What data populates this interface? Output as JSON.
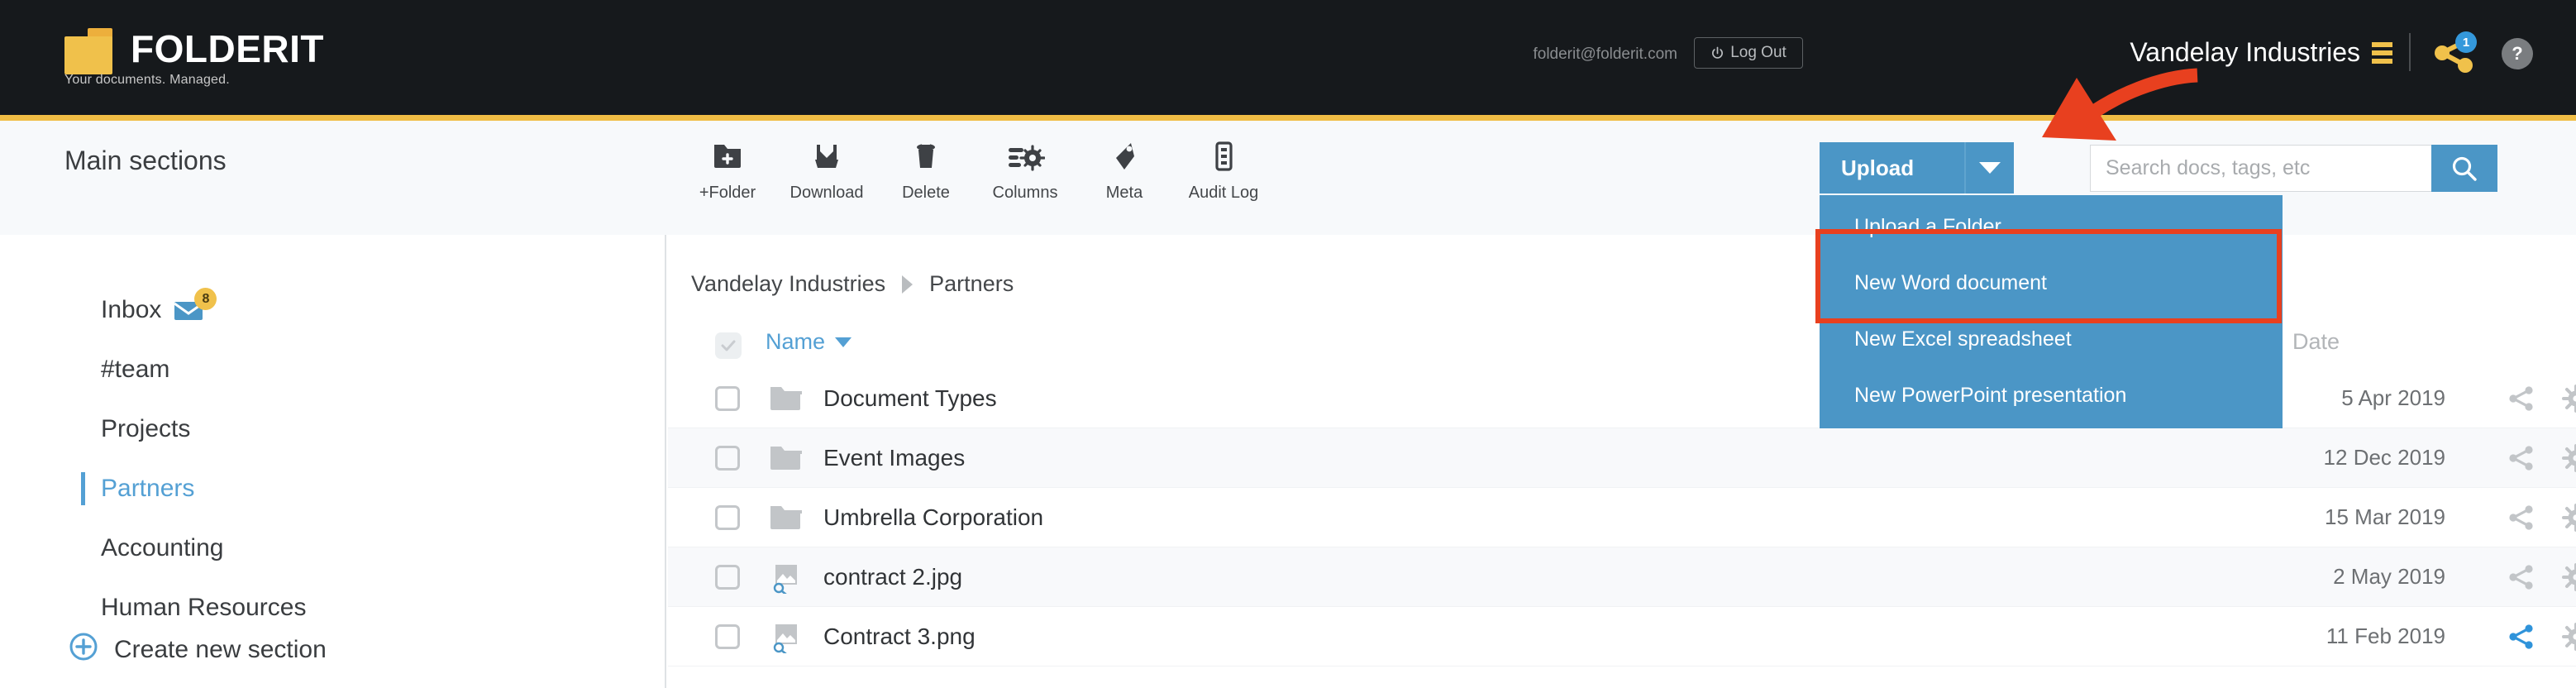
{
  "brand": {
    "name": "FOLDERIT",
    "tagline": "Your documents. Managed.",
    "logo_icon": "folder-logo-icon"
  },
  "header": {
    "account_email": "folderit@folderit.com",
    "logout_label": "Log Out",
    "logout_icon": "power-icon",
    "org_name": "Vandelay Industries",
    "menu_icon": "hamburger-icon",
    "share_icon": "share-icon",
    "share_badge_count": "1",
    "help_icon": "question-mark-icon",
    "help_label": "?"
  },
  "toolbar": {
    "section_title": "Main sections",
    "items": [
      {
        "label": "+Folder",
        "icon": "folder-plus-icon"
      },
      {
        "label": "Download",
        "icon": "download-tray-icon"
      },
      {
        "label": "Delete",
        "icon": "trash-icon"
      },
      {
        "label": "Columns",
        "icon": "columns-settings-icon"
      },
      {
        "label": "Meta",
        "icon": "tag-icon"
      },
      {
        "label": "Audit Log",
        "icon": "audit-log-icon"
      }
    ]
  },
  "upload": {
    "button_label": "Upload",
    "caret_icon": "chevron-down-icon",
    "menu_items": [
      {
        "label": "Upload a Folder"
      },
      {
        "label": "New Word document"
      },
      {
        "label": "New Excel spreadsheet"
      },
      {
        "label": "New PowerPoint presentation"
      }
    ]
  },
  "search": {
    "value": "",
    "placeholder": "Search docs, tags, etc",
    "button_icon": "search-icon"
  },
  "sidebar": {
    "items": [
      {
        "label": "Inbox",
        "badge": "8",
        "icon": "envelope-icon",
        "active": false
      },
      {
        "label": "#team",
        "active": false
      },
      {
        "label": "Projects",
        "active": false
      },
      {
        "label": "Partners",
        "active": true
      },
      {
        "label": "Accounting",
        "active": false
      },
      {
        "label": "Human Resources",
        "active": false
      }
    ],
    "create_label": "Create new section",
    "create_icon": "plus-circle-icon"
  },
  "content": {
    "breadcrumb": [
      "Vandelay Industries",
      "Partners"
    ],
    "columns": {
      "name": "Name",
      "date": "Date",
      "sort_icon": "sort-desc-icon",
      "select_all_icon": "checkbox-checked-icon"
    },
    "rows": [
      {
        "name": "Document Types",
        "date": "5 Apr 2019",
        "icon": "folder-icon",
        "shared": false
      },
      {
        "name": "Event Images",
        "date": "12 Dec 2019",
        "icon": "folder-icon",
        "shared": false
      },
      {
        "name": "Umbrella Corporation",
        "date": "15 Mar 2019",
        "icon": "folder-icon",
        "shared": false
      },
      {
        "name": "contract 2.jpg",
        "date": "2 May 2019",
        "icon": "image-search-icon",
        "shared": false
      },
      {
        "name": "Contract 3.png",
        "date": "11 Feb 2019",
        "icon": "image-search-icon",
        "shared": true
      }
    ],
    "row_action_icons": [
      "share-icon",
      "gear-icon",
      "download-tray-icon"
    ]
  },
  "annotation": {
    "arrow_icon": "red-curved-arrow-icon",
    "highlight_icon": "red-rectangle-highlight"
  },
  "colors": {
    "accent_blue": "#4b96c6",
    "brand_yellow": "#f0c14b",
    "header_black": "#16191c",
    "annotation_red": "#e8401f",
    "link_blue": "#54a0d4"
  }
}
